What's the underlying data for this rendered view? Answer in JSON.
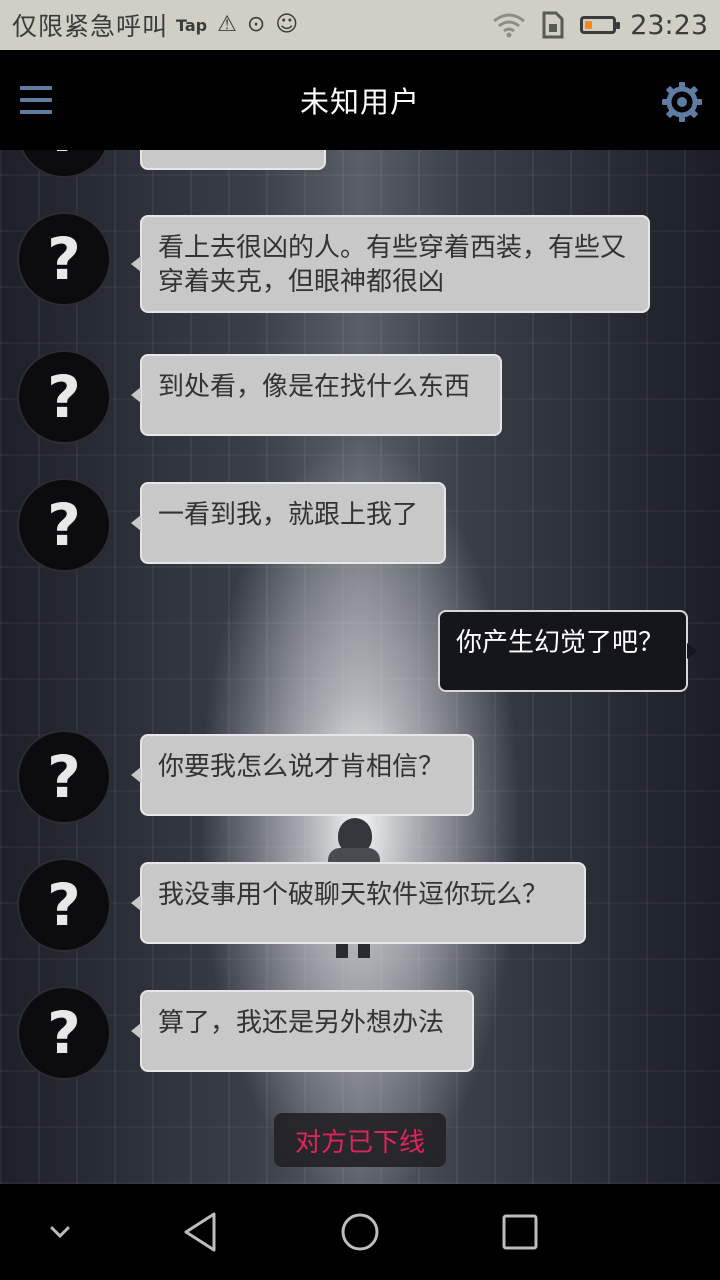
{
  "status_bar": {
    "carrier": "仅限紧急呼叫",
    "tap_label": "Tap",
    "warning_icon": "⚠",
    "app_icon_1": "⊙",
    "app_icon_2": "☺",
    "battery_color": "#f08a1c",
    "time": "23:23"
  },
  "header": {
    "title": "未知用户",
    "menu_icon": "hamburger-menu-icon",
    "settings_icon": "gear-icon",
    "accent": "#5f7ca3"
  },
  "avatar": {
    "glyph": "?"
  },
  "messages": [
    {
      "side": "in",
      "text": "看上去很凶的人。有些穿着西装，有些又穿着夹克，但眼神都很凶"
    },
    {
      "side": "in",
      "text": "到处看，像是在找什么东西"
    },
    {
      "side": "in",
      "text": "一看到我，就跟上我了"
    },
    {
      "side": "out",
      "text": "你产生幻觉了吧？"
    },
    {
      "side": "in",
      "text": "你要我怎么说才肯相信？"
    },
    {
      "side": "in",
      "text": "我没事用个破聊天软件逗你玩么？"
    },
    {
      "side": "in",
      "text": "算了，我还是另外想办法"
    }
  ],
  "offline_notice": "对方已下线",
  "offline_color": "#e0245e",
  "nav": {
    "icons": [
      "chevron-down-icon",
      "back-icon",
      "home-icon",
      "recents-icon"
    ]
  }
}
